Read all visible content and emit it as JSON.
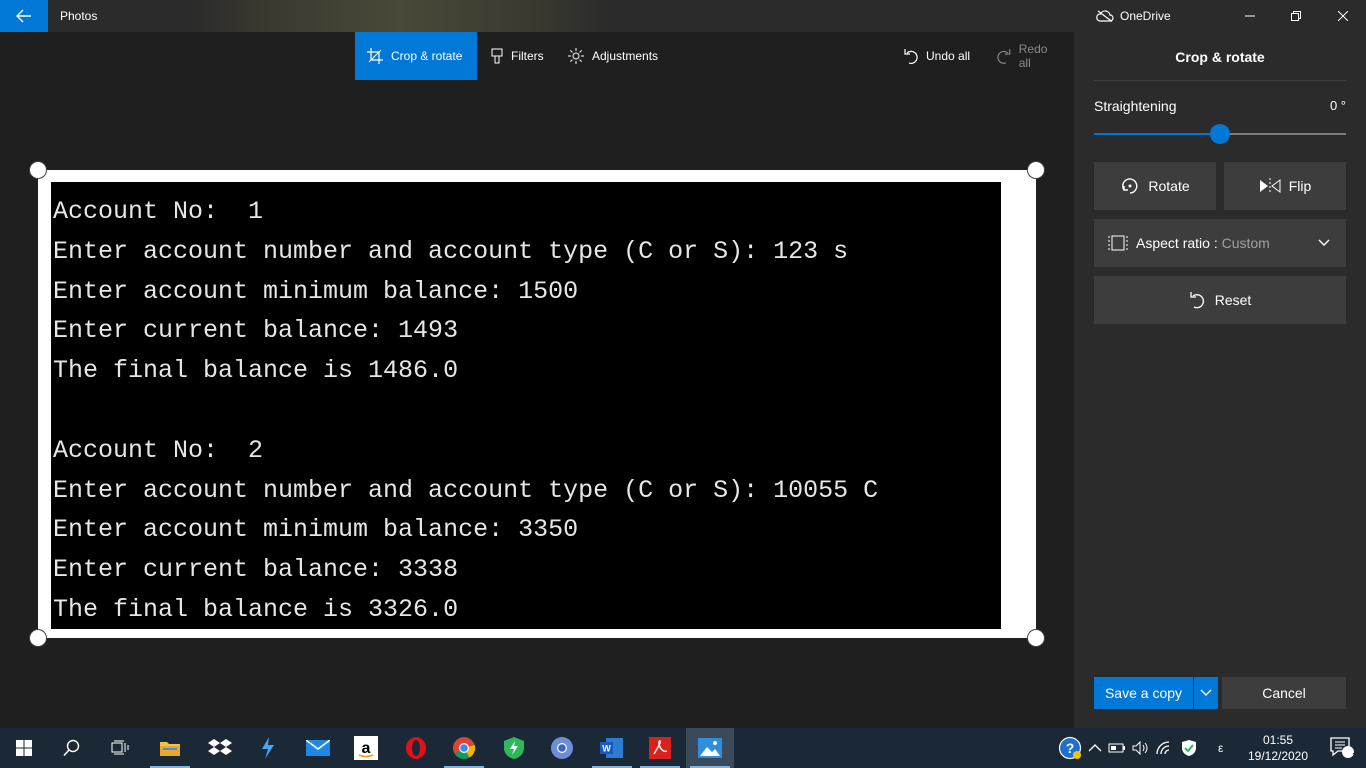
{
  "titlebar": {
    "app_title": "Photos",
    "onedrive_label": "OneDrive"
  },
  "toolbar": {
    "crop_rotate": "Crop & rotate",
    "filters": "Filters",
    "adjustments": "Adjustments",
    "undo_all": "Undo all",
    "redo_all": "Redo all"
  },
  "photo": {
    "lines": [
      "Account No:  1",
      "Enter account number and account type (C or S): 123 s",
      "Enter account minimum balance: 1500",
      "Enter current balance: 1493",
      "The final balance is 1486.0",
      "",
      "Account No:  2",
      "Enter account number and account type (C or S): 10055 C",
      "Enter account minimum balance: 3350",
      "Enter current balance: 3338",
      "The final balance is 3326.0"
    ]
  },
  "panel": {
    "title": "Crop & rotate",
    "straightening_label": "Straightening",
    "straightening_value": "0 °",
    "straightening_level": 0.5,
    "rotate": "Rotate",
    "flip": "Flip",
    "aspect_label": "Aspect ratio : ",
    "aspect_value": "Custom",
    "reset": "Reset",
    "save_copy": "Save a copy",
    "cancel": "Cancel"
  },
  "taskbar": {
    "time": "01:55",
    "date": "19/12/2020",
    "notification_count": "1",
    "ime": "ε"
  },
  "colors": {
    "accent": "#0078d7",
    "panel_bg": "#2b2b2b",
    "canvas_bg": "#1f1f1f",
    "button_bg": "#3d3d3d",
    "taskbar_bg": "#1b2836"
  },
  "icons": {
    "back": "back-arrow-icon",
    "onedrive": "cloud-icon",
    "crop": "crop-icon",
    "filters": "brush-icon",
    "adjustments": "sun-icon",
    "undo": "undo-icon",
    "redo": "redo-icon",
    "rotate": "rotate-icon",
    "flip": "flip-icon",
    "aspect": "aspect-ratio-icon",
    "reset": "reset-icon"
  }
}
